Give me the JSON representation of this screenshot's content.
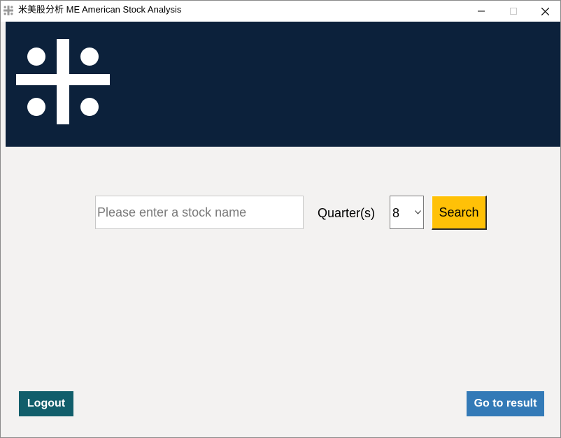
{
  "window": {
    "title": "米美股分析 ME American Stock Analysis",
    "icon": "app-logo-icon",
    "controls": [
      "minimize-icon",
      "maximize-icon",
      "close-icon"
    ]
  },
  "banner": {
    "logo": "hashtag-dots-logo",
    "background_color": "#0c213b"
  },
  "search": {
    "placeholder": "Please enter a stock name",
    "value": ""
  },
  "quarter": {
    "label": "Quarter(s)",
    "selected": "8"
  },
  "buttons": {
    "search": "Search",
    "logout": "Logout",
    "result": "Go to result"
  },
  "colors": {
    "search_button": "#ffc107",
    "logout_button": "#115e6b",
    "result_button": "#337ab7",
    "content_background": "#f3f2f1"
  }
}
